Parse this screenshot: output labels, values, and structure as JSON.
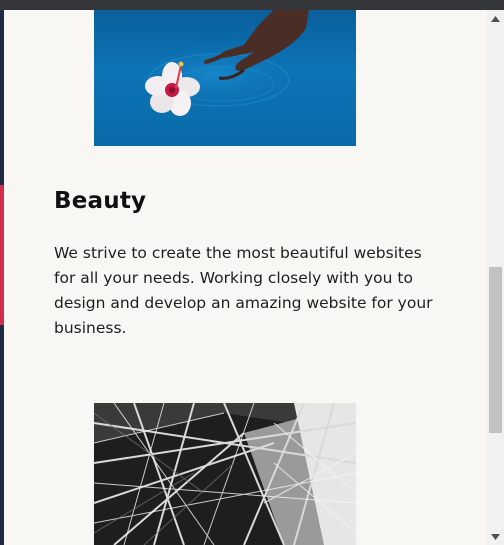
{
  "section": {
    "heading": "Beauty",
    "body": "We strive to create the most beautiful websites for all your needs. Working closely with you to design and develop an amazing website for your business."
  },
  "images": {
    "first": "hand-flower-water-photo",
    "second": "steel-structure-photo"
  },
  "scrollbar": {
    "up_icon": "chevron-up-icon",
    "down_icon": "chevron-down-icon",
    "thumb_position_fraction": 0.5
  },
  "colors": {
    "page_background": "#f9f7f4",
    "accent": "#d22d4b"
  }
}
